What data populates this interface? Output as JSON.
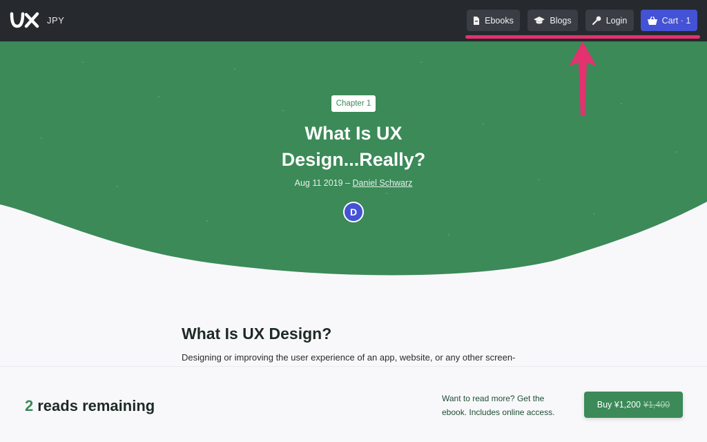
{
  "header": {
    "currency": "JPY",
    "nav": {
      "ebooks": "Ebooks",
      "blogs": "Blogs",
      "login": "Login",
      "cart": "Cart · 1"
    }
  },
  "hero": {
    "chapter": "Chapter 1",
    "title_line1": "What Is UX",
    "title_line2": "Design...Really?",
    "date": "Aug 11 2019 –",
    "author": "Daniel Schwarz",
    "avatar_initial": "D"
  },
  "article": {
    "heading": "What Is UX Design?",
    "intro": "Designing or improving the user experience of an app, website, or any other screen-"
  },
  "paywall": {
    "count": "2",
    "reads_label": "reads remaining",
    "promo": "Want to read more? Get the ebook. Includes online access.",
    "buy_label": "Buy ¥1,200",
    "old_price": "¥1,400"
  },
  "colors": {
    "nav_bg": "#262a2f",
    "brand_green": "#3b8a58",
    "cart_blue": "#4452d6",
    "annotation_pink": "#e4316f"
  },
  "icons": [
    "ux-logo",
    "pdf-file-icon",
    "graduation-cap-icon",
    "key-icon",
    "basket-icon"
  ]
}
